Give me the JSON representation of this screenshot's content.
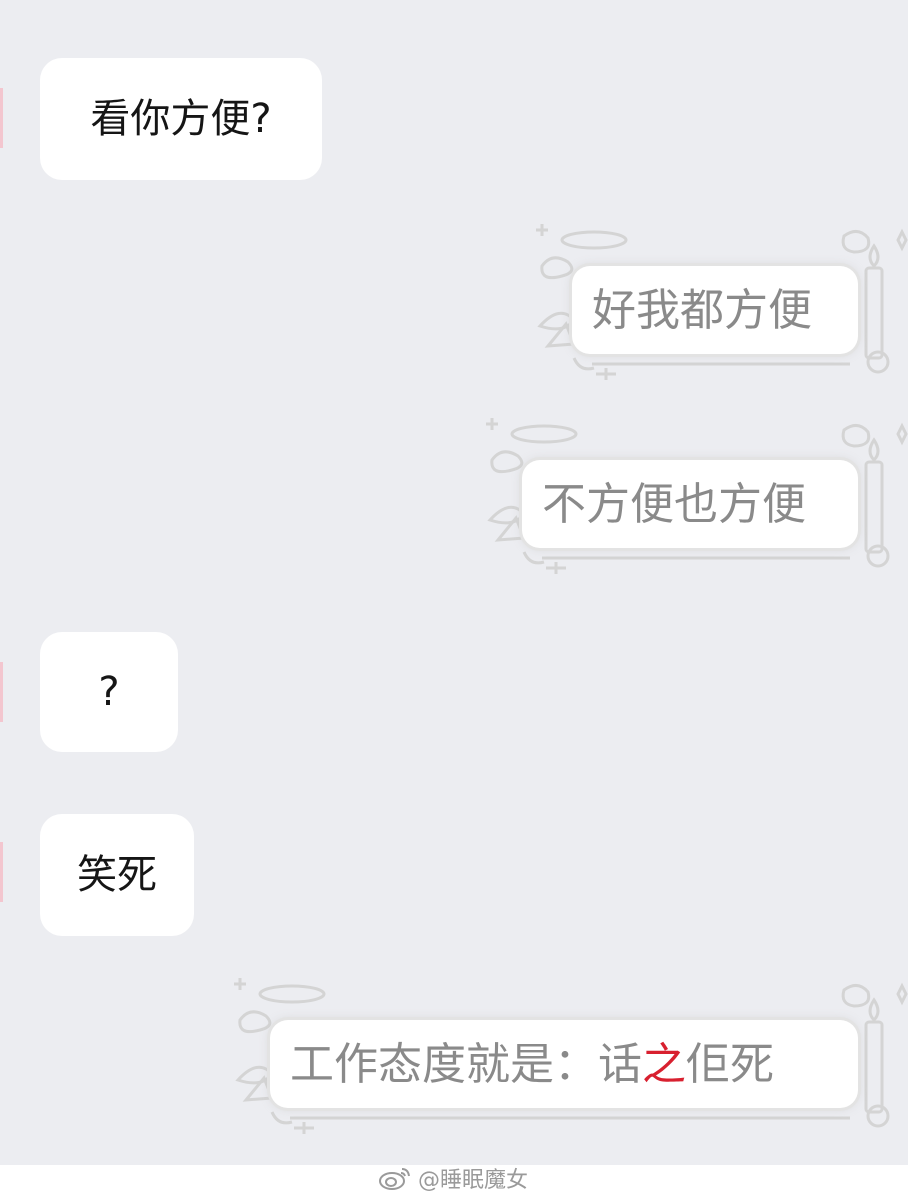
{
  "messages": {
    "in1": "看你方便?",
    "out1": "好我都方便",
    "out2": "不方便也方便",
    "in2": "?",
    "in3": "笑死",
    "out3_a": "工作态度就是：话",
    "out3_b": "之",
    "out3_c": "佢死"
  },
  "watermark": {
    "icon": "weibo-icon",
    "handle": "@睡眠魔女"
  },
  "colors": {
    "background": "#ecedf1",
    "incoming_bubble": "#ffffff",
    "outgoing_text": "#8a8a8a",
    "decoration": "#d6d6d6",
    "accent": "#d8202f"
  }
}
